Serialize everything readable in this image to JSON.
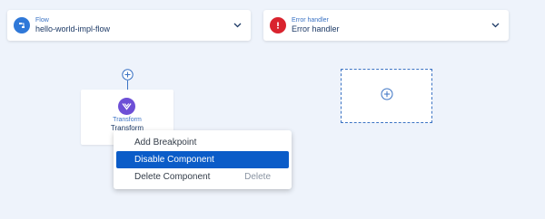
{
  "flow_card": {
    "type_label": "Flow",
    "name": "hello-world-impl-flow",
    "icon": "flow-icon",
    "accent": "#2f78d8"
  },
  "error_card": {
    "type_label": "Error handler",
    "name": "Error handler",
    "icon": "error-icon",
    "accent": "#d9232e"
  },
  "transform_component": {
    "type_label": "Transform",
    "name": "Transform",
    "icon": "transform-icon",
    "accent": "#6d4fd6"
  },
  "context_menu": {
    "items": [
      {
        "label": "Add Breakpoint",
        "shortcut": ""
      },
      {
        "label": "Disable Component",
        "shortcut": "",
        "active": true
      },
      {
        "label": "Delete Component",
        "shortcut": "Delete"
      }
    ]
  },
  "colors": {
    "canvas": "#eef3fb",
    "link": "#3b73c4",
    "selected": "#0b5cc8"
  }
}
